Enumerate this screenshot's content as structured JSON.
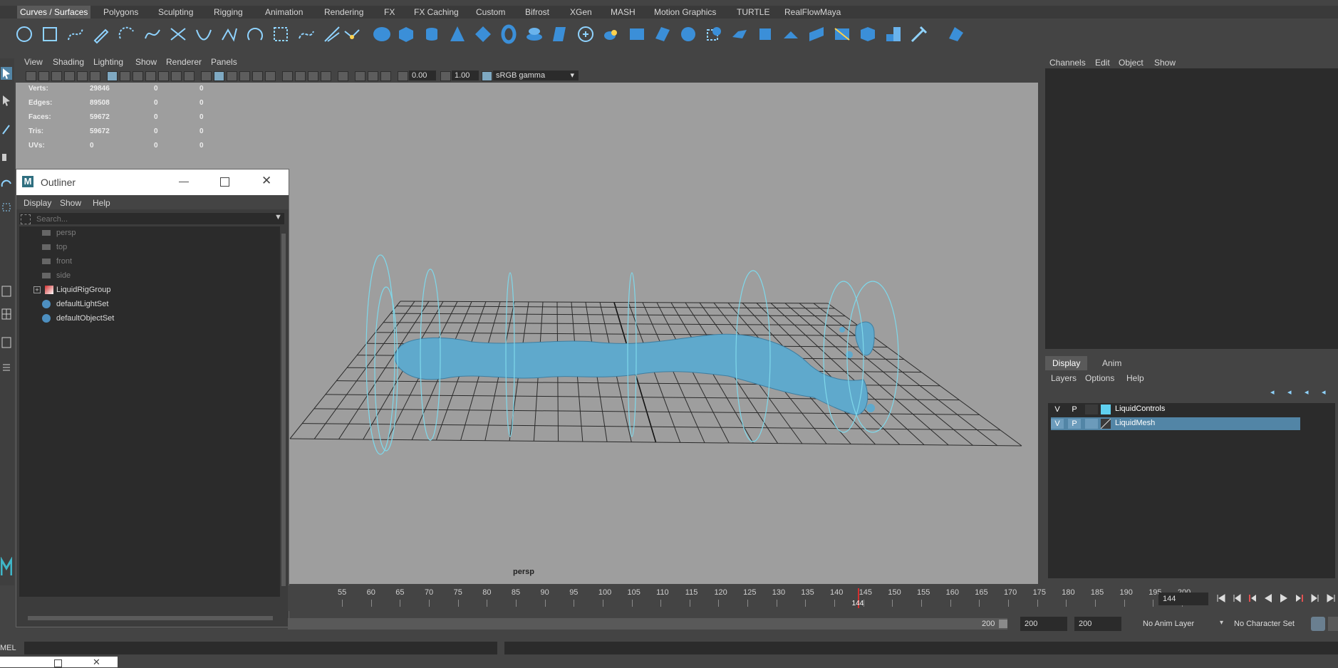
{
  "shelf_tabs": [
    "Curves / Surfaces",
    "Polygons",
    "Sculpting",
    "Rigging",
    "Animation",
    "Rendering",
    "FX",
    "FX Caching",
    "Custom",
    "Bifrost",
    "XGen",
    "MASH",
    "Motion Graphics",
    "TURTLE",
    "RealFlowMaya"
  ],
  "viewport": {
    "menu": [
      "View",
      "Shading",
      "Lighting",
      "Show",
      "Renderer",
      "Panels"
    ],
    "exposure": "0.00",
    "gamma": "1.00",
    "color_space": "sRGB gamma",
    "camera": "persp",
    "hud": [
      {
        "label": "Verts:",
        "v1": "29846",
        "v2": "0",
        "v3": "0"
      },
      {
        "label": "Edges:",
        "v1": "89508",
        "v2": "0",
        "v3": "0"
      },
      {
        "label": "Faces:",
        "v1": "59672",
        "v2": "0",
        "v3": "0"
      },
      {
        "label": "Tris:",
        "v1": "59672",
        "v2": "0",
        "v3": "0"
      },
      {
        "label": "UVs:",
        "v1": "0",
        "v2": "0",
        "v3": "0"
      }
    ]
  },
  "outliner": {
    "title": "Outliner",
    "menu": [
      "Display",
      "Show",
      "Help"
    ],
    "search_placeholder": "Search...",
    "items": [
      "persp",
      "top",
      "front",
      "side",
      "LiquidRigGroup",
      "defaultLightSet",
      "defaultObjectSet"
    ]
  },
  "channel_box": {
    "menu": [
      "Channels",
      "Edit",
      "Object",
      "Show"
    ]
  },
  "layer_editor": {
    "tabs": [
      "Display",
      "Anim"
    ],
    "menu": [
      "Layers",
      "Options",
      "Help"
    ],
    "layers": [
      {
        "v": "V",
        "p": "P",
        "name": "LiquidControls",
        "color": "#5fd0f0"
      },
      {
        "v": "V",
        "p": "P",
        "name": "LiquidMesh",
        "color": ""
      }
    ]
  },
  "time_slider": {
    "ticks": [
      "55",
      "60",
      "65",
      "70",
      "75",
      "80",
      "85",
      "90",
      "95",
      "100",
      "105",
      "110",
      "115",
      "120",
      "125",
      "130",
      "135",
      "140",
      "145",
      "150",
      "155",
      "160",
      "165",
      "170",
      "175",
      "180",
      "185",
      "190",
      "195",
      "200"
    ],
    "current_frame": "144",
    "frame_field": "144"
  },
  "range": {
    "end_label": "200",
    "field1": "200",
    "field2": "200",
    "anim_layer": "No Anim Layer",
    "character_set": "No Character Set"
  },
  "command_line": {
    "label": "MEL"
  },
  "colors": {
    "accent_blue": "#5285a6",
    "liquid": "#5fa9cc",
    "rig": "#7fd8ea"
  }
}
